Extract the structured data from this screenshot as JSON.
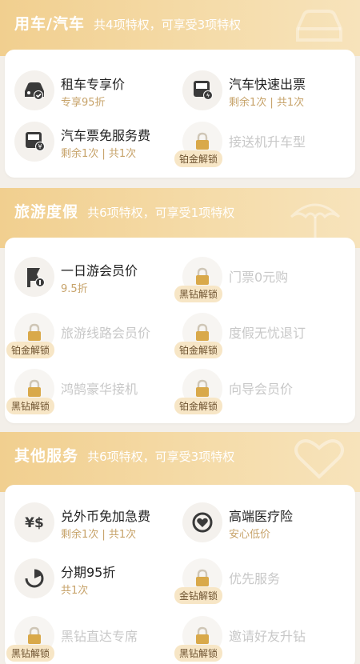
{
  "sections": [
    {
      "title": "用车/汽车",
      "subtitle": "共4项特权，可享受3项特权",
      "items": [
        {
          "title": "租车专享价",
          "sub": "专享95折",
          "icon": "car-check-icon",
          "locked": false
        },
        {
          "title": "汽车快速出票",
          "sub": "剩余1次 | 共1次",
          "icon": "bus-lightning-icon",
          "locked": false
        },
        {
          "title": "汽车票免服务费",
          "sub": "剩余1次 | 共1次",
          "icon": "bus-yen-icon",
          "locked": false
        },
        {
          "title": "接送机升车型",
          "badge": "铂金解锁",
          "icon": "lock-icon",
          "locked": true
        }
      ]
    },
    {
      "title": "旅游度假",
      "subtitle": "共6项特权，可享受1项特权",
      "items": [
        {
          "title": "一日游会员价",
          "sub": "9.5折",
          "icon": "flag-tour-icon",
          "locked": false
        },
        {
          "title": "门票0元购",
          "badge": "黑钻解锁",
          "icon": "lock-icon",
          "locked": true
        },
        {
          "title": "旅游线路会员价",
          "badge": "铂金解锁",
          "icon": "lock-icon",
          "locked": true
        },
        {
          "title": "度假无忧退订",
          "badge": "铂金解锁",
          "icon": "lock-icon",
          "locked": true
        },
        {
          "title": "鸿鹄豪华接机",
          "badge": "黑钻解锁",
          "icon": "lock-icon",
          "locked": true
        },
        {
          "title": "向导会员价",
          "badge": "铂金解锁",
          "icon": "lock-icon",
          "locked": true
        }
      ]
    },
    {
      "title": "其他服务",
      "subtitle": "共6项特权，可享受3项特权",
      "items": [
        {
          "title": "兑外币免加急费",
          "sub": "剩余1次 | 共1次",
          "icon": "currency-exchange-icon",
          "locked": false
        },
        {
          "title": "高端医疗险",
          "sub": "安心低价",
          "icon": "medical-heart-icon",
          "locked": false
        },
        {
          "title": "分期95折",
          "sub": "共1次",
          "icon": "installment-icon",
          "locked": false
        },
        {
          "title": "优先服务",
          "badge": "金钻解锁",
          "icon": "lock-icon",
          "locked": true
        },
        {
          "title": "黑钻直达专席",
          "badge": "黑钻解锁",
          "icon": "lock-icon",
          "locked": true
        },
        {
          "title": "邀请好友升钻",
          "badge": "黑钻解锁",
          "icon": "lock-icon",
          "locked": true
        }
      ]
    }
  ],
  "colors": {
    "accent": "#c7a36a",
    "header": "#f1cf8f",
    "locked_text": "#c8c8c8"
  }
}
